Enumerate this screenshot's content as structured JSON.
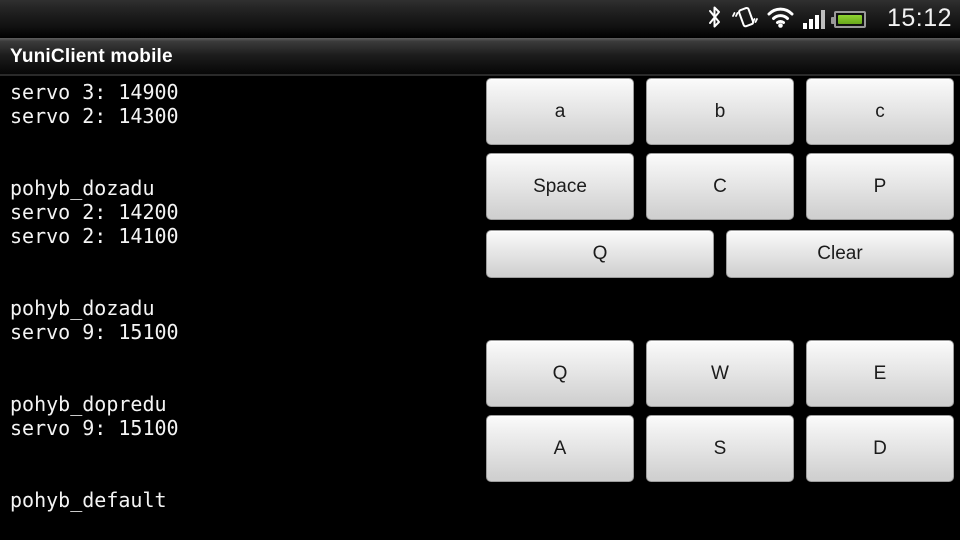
{
  "status_bar": {
    "icons": [
      {
        "name": "bluetooth-icon",
        "label": "Bluetooth"
      },
      {
        "name": "vibrate-icon",
        "label": "Vibrate mode"
      },
      {
        "name": "wifi-icon",
        "label": "Wi-Fi"
      },
      {
        "name": "cellular-signal-icon",
        "label": "Cellular signal"
      },
      {
        "name": "battery-icon",
        "label": "Battery"
      }
    ],
    "clock": "15:12",
    "battery_color": "#8fd531"
  },
  "title_bar": {
    "app_title": "YuniClient mobile"
  },
  "log": {
    "lines": [
      "servo 3: 14900",
      "servo 2: 14300",
      "",
      "",
      "pohyb_dozadu",
      "servo 2: 14200",
      "servo 2: 14100",
      "",
      "",
      "pohyb_dozadu",
      "servo 9: 15100",
      "",
      "",
      "pohyb_dopredu",
      "servo 9: 15100",
      "",
      "",
      "pohyb_default"
    ]
  },
  "keypad": {
    "group_commands": {
      "row1": [
        {
          "label": "a",
          "name": "button-a"
        },
        {
          "label": "b",
          "name": "button-b"
        },
        {
          "label": "c",
          "name": "button-c"
        }
      ],
      "row2": [
        {
          "label": "Space",
          "name": "button-space"
        },
        {
          "label": "C",
          "name": "button-c-upper"
        },
        {
          "label": "P",
          "name": "button-p"
        }
      ],
      "row3": [
        {
          "label": "Q",
          "name": "button-q-wide"
        },
        {
          "label": "Clear",
          "name": "button-clear"
        }
      ]
    },
    "group_movement": {
      "row1": [
        {
          "label": "Q",
          "name": "button-q"
        },
        {
          "label": "W",
          "name": "button-w"
        },
        {
          "label": "E",
          "name": "button-e"
        }
      ],
      "row2": [
        {
          "label": "A",
          "name": "button-a-upper"
        },
        {
          "label": "S",
          "name": "button-s"
        },
        {
          "label": "D",
          "name": "button-d"
        }
      ]
    }
  }
}
